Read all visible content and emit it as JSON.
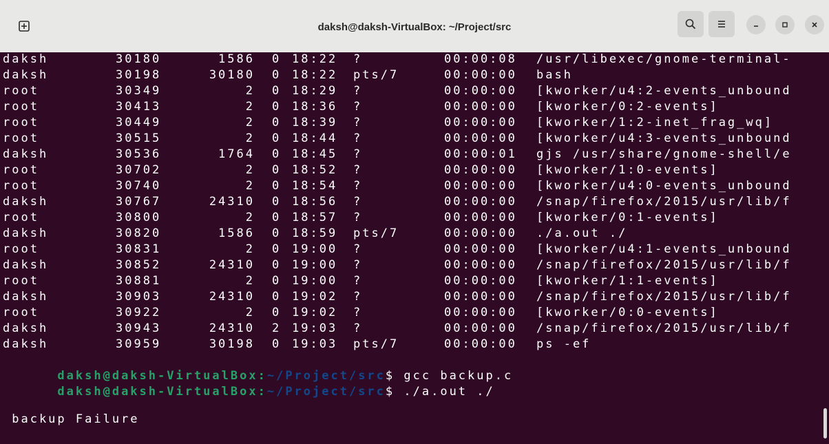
{
  "window": {
    "title": "daksh@daksh-VirtualBox: ~/Project/src"
  },
  "icons": {
    "new_tab": "new-tab-icon",
    "search": "search-icon",
    "menu": "hamburger-menu-icon",
    "minimize": "minimize-icon",
    "maximize": "maximize-icon",
    "close": "close-icon"
  },
  "colors": {
    "terminal_bg": "#300a24",
    "prompt_user": "#26a269",
    "prompt_path": "#12488b",
    "text": "#ffffff",
    "titlebar_bg": "#e8e8e7"
  },
  "process_rows": [
    {
      "uid": "daksh",
      "pid": "30180",
      "ppid": "1586",
      "c": "0",
      "stime": "18:22",
      "tty": "?",
      "time": "00:00:08",
      "cmd": "/usr/libexec/gnome-terminal-"
    },
    {
      "uid": "daksh",
      "pid": "30198",
      "ppid": "30180",
      "c": "0",
      "stime": "18:22",
      "tty": "pts/7",
      "time": "00:00:00",
      "cmd": "bash"
    },
    {
      "uid": "root",
      "pid": "30349",
      "ppid": "2",
      "c": "0",
      "stime": "18:29",
      "tty": "?",
      "time": "00:00:00",
      "cmd": "[kworker/u4:2-events_unbound"
    },
    {
      "uid": "root",
      "pid": "30413",
      "ppid": "2",
      "c": "0",
      "stime": "18:36",
      "tty": "?",
      "time": "00:00:00",
      "cmd": "[kworker/0:2-events]"
    },
    {
      "uid": "root",
      "pid": "30449",
      "ppid": "2",
      "c": "0",
      "stime": "18:39",
      "tty": "?",
      "time": "00:00:00",
      "cmd": "[kworker/1:2-inet_frag_wq]"
    },
    {
      "uid": "root",
      "pid": "30515",
      "ppid": "2",
      "c": "0",
      "stime": "18:44",
      "tty": "?",
      "time": "00:00:00",
      "cmd": "[kworker/u4:3-events_unbound"
    },
    {
      "uid": "daksh",
      "pid": "30536",
      "ppid": "1764",
      "c": "0",
      "stime": "18:45",
      "tty": "?",
      "time": "00:00:01",
      "cmd": "gjs /usr/share/gnome-shell/e"
    },
    {
      "uid": "root",
      "pid": "30702",
      "ppid": "2",
      "c": "0",
      "stime": "18:52",
      "tty": "?",
      "time": "00:00:00",
      "cmd": "[kworker/1:0-events]"
    },
    {
      "uid": "root",
      "pid": "30740",
      "ppid": "2",
      "c": "0",
      "stime": "18:54",
      "tty": "?",
      "time": "00:00:00",
      "cmd": "[kworker/u4:0-events_unbound"
    },
    {
      "uid": "daksh",
      "pid": "30767",
      "ppid": "24310",
      "c": "0",
      "stime": "18:56",
      "tty": "?",
      "time": "00:00:00",
      "cmd": "/snap/firefox/2015/usr/lib/f"
    },
    {
      "uid": "root",
      "pid": "30800",
      "ppid": "2",
      "c": "0",
      "stime": "18:57",
      "tty": "?",
      "time": "00:00:00",
      "cmd": "[kworker/0:1-events]"
    },
    {
      "uid": "daksh",
      "pid": "30820",
      "ppid": "1586",
      "c": "0",
      "stime": "18:59",
      "tty": "pts/7",
      "time": "00:00:00",
      "cmd": "./a.out ./"
    },
    {
      "uid": "root",
      "pid": "30831",
      "ppid": "2",
      "c": "0",
      "stime": "19:00",
      "tty": "?",
      "time": "00:00:00",
      "cmd": "[kworker/u4:1-events_unbound"
    },
    {
      "uid": "daksh",
      "pid": "30852",
      "ppid": "24310",
      "c": "0",
      "stime": "19:00",
      "tty": "?",
      "time": "00:00:00",
      "cmd": "/snap/firefox/2015/usr/lib/f"
    },
    {
      "uid": "root",
      "pid": "30881",
      "ppid": "2",
      "c": "0",
      "stime": "19:00",
      "tty": "?",
      "time": "00:00:00",
      "cmd": "[kworker/1:1-events]"
    },
    {
      "uid": "daksh",
      "pid": "30903",
      "ppid": "24310",
      "c": "0",
      "stime": "19:02",
      "tty": "?",
      "time": "00:00:00",
      "cmd": "/snap/firefox/2015/usr/lib/f"
    },
    {
      "uid": "root",
      "pid": "30922",
      "ppid": "2",
      "c": "0",
      "stime": "19:02",
      "tty": "?",
      "time": "00:00:00",
      "cmd": "[kworker/0:0-events]"
    },
    {
      "uid": "daksh",
      "pid": "30943",
      "ppid": "24310",
      "c": "2",
      "stime": "19:03",
      "tty": "?",
      "time": "00:00:00",
      "cmd": "/snap/firefox/2015/usr/lib/f"
    },
    {
      "uid": "daksh",
      "pid": "30959",
      "ppid": "30198",
      "c": "0",
      "stime": "19:03",
      "tty": "pts/7",
      "time": "00:00:00",
      "cmd": "ps -ef"
    }
  ],
  "prompt": {
    "user_host": "daksh@daksh-VirtualBox",
    "sep": ":",
    "path": "~/Project/src",
    "dollar": "$"
  },
  "commands": {
    "cmd1": " gcc backup.c",
    "cmd2": " ./a.out ./"
  },
  "output": {
    "line": " backup Failure"
  }
}
